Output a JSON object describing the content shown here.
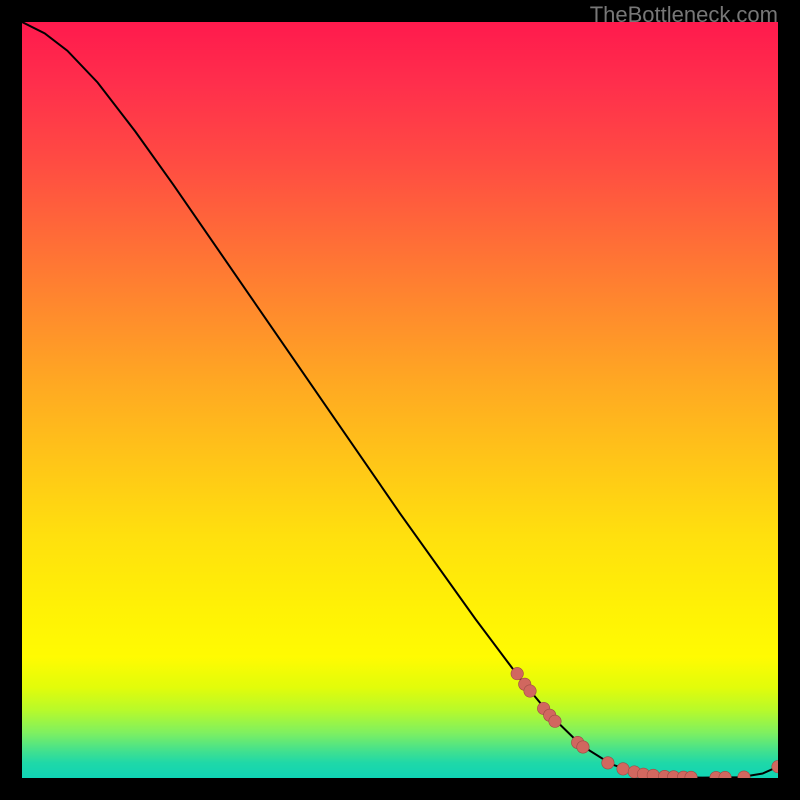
{
  "attribution": "TheBottleneck.com",
  "colors": {
    "page_bg": "#000000",
    "curve": "#000000",
    "marker_fill": "#d1675f",
    "marker_stroke": "#9c4a44"
  },
  "chart_data": {
    "type": "line",
    "title": "",
    "xlabel": "",
    "ylabel": "",
    "xlim": [
      0,
      100
    ],
    "ylim": [
      0,
      100
    ],
    "grid": false,
    "background_gradient": "red-yellow-green (top to bottom)",
    "curve": {
      "description": "Bottleneck curve: steep decline then flattening near zero",
      "points": [
        {
          "x": 0,
          "y": 100
        },
        {
          "x": 3,
          "y": 98.5
        },
        {
          "x": 6,
          "y": 96.2
        },
        {
          "x": 10,
          "y": 92.0
        },
        {
          "x": 15,
          "y": 85.5
        },
        {
          "x": 20,
          "y": 78.5
        },
        {
          "x": 30,
          "y": 64.0
        },
        {
          "x": 40,
          "y": 49.5
        },
        {
          "x": 50,
          "y": 35.0
        },
        {
          "x": 60,
          "y": 21.0
        },
        {
          "x": 66,
          "y": 13.0
        },
        {
          "x": 70,
          "y": 8.2
        },
        {
          "x": 74,
          "y": 4.3
        },
        {
          "x": 78,
          "y": 1.8
        },
        {
          "x": 82,
          "y": 0.5
        },
        {
          "x": 86,
          "y": 0.1
        },
        {
          "x": 90,
          "y": 0.05
        },
        {
          "x": 95,
          "y": 0.1
        },
        {
          "x": 98,
          "y": 0.6
        },
        {
          "x": 100,
          "y": 1.5
        }
      ]
    },
    "markers": {
      "description": "Highlighted data points on right portion of curve",
      "points": [
        {
          "x": 65.5,
          "y": 13.8
        },
        {
          "x": 66.5,
          "y": 12.4
        },
        {
          "x": 67.2,
          "y": 11.5
        },
        {
          "x": 69.0,
          "y": 9.2
        },
        {
          "x": 69.8,
          "y": 8.3
        },
        {
          "x": 70.5,
          "y": 7.5
        },
        {
          "x": 73.5,
          "y": 4.7
        },
        {
          "x": 74.2,
          "y": 4.1
        },
        {
          "x": 77.5,
          "y": 2.0
        },
        {
          "x": 79.5,
          "y": 1.2
        },
        {
          "x": 81.0,
          "y": 0.8
        },
        {
          "x": 82.2,
          "y": 0.5
        },
        {
          "x": 83.5,
          "y": 0.35
        },
        {
          "x": 85.0,
          "y": 0.2
        },
        {
          "x": 86.2,
          "y": 0.15
        },
        {
          "x": 87.5,
          "y": 0.1
        },
        {
          "x": 88.5,
          "y": 0.08
        },
        {
          "x": 91.8,
          "y": 0.05
        },
        {
          "x": 93.0,
          "y": 0.06
        },
        {
          "x": 95.5,
          "y": 0.12
        },
        {
          "x": 100.0,
          "y": 1.5
        }
      ]
    }
  }
}
